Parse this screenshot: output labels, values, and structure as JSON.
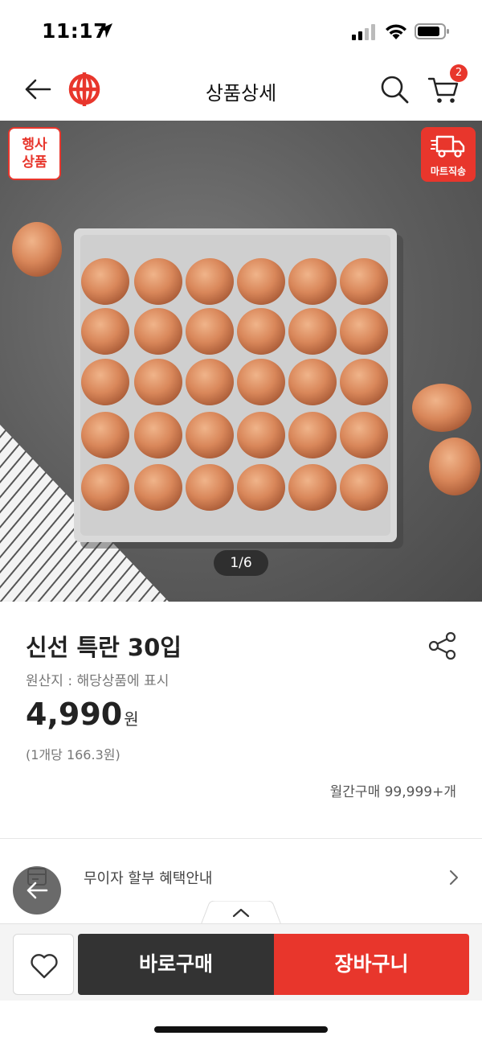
{
  "status_bar": {
    "time": "11:17"
  },
  "header": {
    "title": "상품상세",
    "cart_count": "2"
  },
  "product_image": {
    "event_badge": "행사\n상품",
    "event_badge_line1": "행사",
    "event_badge_line2": "상품",
    "delivery_badge": "마트직송",
    "page_indicator": "1/6"
  },
  "product": {
    "name": "신선 특란 30입",
    "origin": "원산지 : 해당상품에 표시",
    "price": "4,990",
    "price_unit": "원",
    "unit_price": "(1개당 166.3원)",
    "monthly_purchases": "월간구매 99,999+개"
  },
  "benefit": {
    "label": "무이자 할부 혜택안내"
  },
  "actions": {
    "buy_now": "바로구매",
    "add_to_cart": "장바구니"
  },
  "colors": {
    "brand_red": "#e8362c",
    "buy_button": "#333333"
  }
}
